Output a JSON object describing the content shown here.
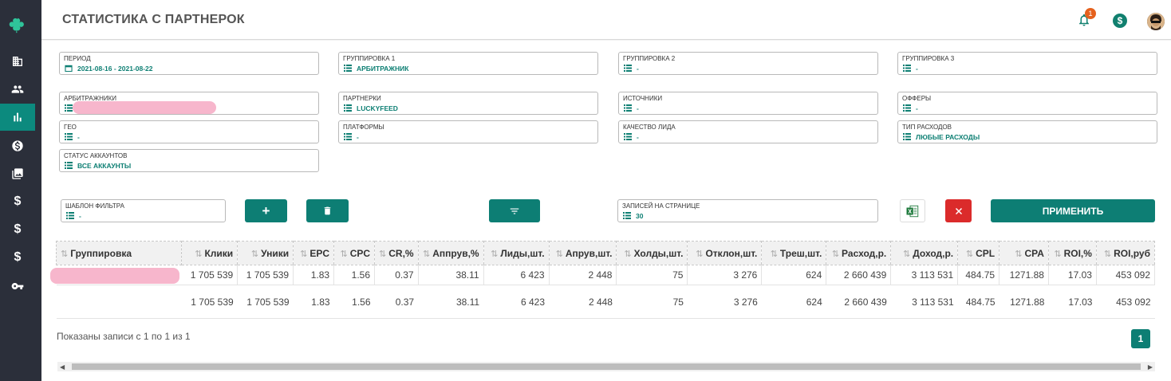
{
  "header": {
    "title": "СТАТИСТИКА С ПАРТНЕРОК",
    "notifications_count": "1",
    "dollar_icon": "$"
  },
  "filters": {
    "period": {
      "label": "ПЕРИОД",
      "value": "2021-08-16 - 2021-08-22"
    },
    "group1": {
      "label": "ГРУППИРОВКА 1",
      "value": "АРБИТРАЖНИК"
    },
    "group2": {
      "label": "ГРУППИРОВКА 2",
      "value": "-"
    },
    "group3": {
      "label": "ГРУППИРОВКА 3",
      "value": "-"
    },
    "arbitrators": {
      "label": "АРБИТРАЖНИКИ",
      "value": ""
    },
    "partners": {
      "label": "ПАРТНЕРКИ",
      "value": "LUCKYFEED"
    },
    "sources": {
      "label": "ИСТОЧНИКИ",
      "value": "-"
    },
    "offers": {
      "label": "ОФФЕРЫ",
      "value": "-"
    },
    "geo": {
      "label": "ГЕО",
      "value": "-"
    },
    "platforms": {
      "label": "ПЛАТФОРМЫ",
      "value": "-"
    },
    "lead_quality": {
      "label": "КАЧЕСТВО ЛИДА",
      "value": "-"
    },
    "expense_type": {
      "label": "ТИП РАСХОДОВ",
      "value": "ЛЮБЫЕ РАСХОДЫ"
    },
    "account_status": {
      "label": "СТАТУС АККАУНТОВ",
      "value": "ВСЕ АККАУНТЫ"
    },
    "filter_template": {
      "label": "ШАБЛОН ФИЛЬТРА",
      "value": "-"
    },
    "records_per_page": {
      "label": "ЗАПИСЕЙ НА СТРАНИЦЕ",
      "value": "30"
    }
  },
  "buttons": {
    "add": "+",
    "apply": "ПРИМЕНИТЬ"
  },
  "table": {
    "headers": [
      "Группировка",
      "Клики",
      "Уники",
      "EPC",
      "CPC",
      "CR,%",
      "Аппрув,%",
      "Лиды,шт.",
      "Апрув,шт.",
      "Холды,шт.",
      "Отклон,шт.",
      "Треш,шт.",
      "Расход,р.",
      "Доход,р.",
      "CPL",
      "CPA",
      "ROI,%",
      "ROI,руб"
    ],
    "rows": [
      [
        "",
        "1 705 539",
        "1 705 539",
        "1.83",
        "1.56",
        "0.37",
        "38.11",
        "6 423",
        "2 448",
        "75",
        "3 276",
        "624",
        "2 660 439",
        "3 113 531",
        "484.75",
        "1271.88",
        "17.03",
        "453 092"
      ]
    ],
    "totals": [
      "",
      "1 705 539",
      "1 705 539",
      "1.83",
      "1.56",
      "0.37",
      "38.11",
      "6 423",
      "2 448",
      "75",
      "3 276",
      "624",
      "2 660 439",
      "3 113 531",
      "484.75",
      "1271.88",
      "17.03",
      "453 092"
    ]
  },
  "pagination": {
    "info": "Показаны записи с 1 по 1 из 1",
    "current_page": "1"
  }
}
